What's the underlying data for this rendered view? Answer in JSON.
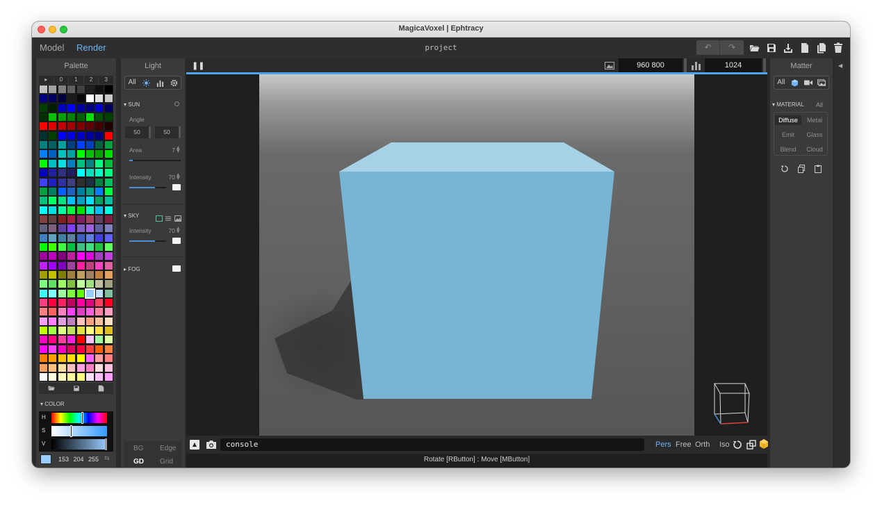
{
  "window": {
    "title": "MagicaVoxel | Ephtracy"
  },
  "topbar": {
    "modes": [
      "Model",
      "Render"
    ],
    "active_mode": "Render",
    "project_name": "project",
    "icons": [
      "undo-icon",
      "redo-icon",
      "open-folder-icon",
      "save-icon",
      "export-icon",
      "new-file-icon",
      "copy-file-icon",
      "delete-icon"
    ]
  },
  "palette": {
    "title": "Palette",
    "tabs": [
      "▸",
      "0",
      "1",
      "2",
      "3"
    ],
    "selected_color": "#99ccff",
    "footer_icons": [
      "open-folder-icon",
      "save-icon",
      "file-icon"
    ],
    "color_section": "COLOR",
    "hsv_labels": [
      "H",
      "S",
      "V"
    ],
    "rgb": "153 204 255",
    "swap_icon": "swap-icon"
  },
  "light": {
    "title": "Light",
    "filter_tabs": [
      "All",
      "sun-icon",
      "chart-icon",
      "gear-icon"
    ],
    "sun": {
      "label": "SUN",
      "angle_label": "Angle",
      "angle_values": [
        "50",
        "50"
      ],
      "area_label": "Area",
      "area_value": "7",
      "intensity_label": "Intensity",
      "intensity_value": "70",
      "intensity_fraction": 0.7,
      "area_fraction": 0.07
    },
    "sky": {
      "label": "SKY",
      "intensity_label": "Intensity",
      "intensity_value": "70",
      "intensity_fraction": 0.7
    },
    "fog": {
      "label": "FOG"
    },
    "bottom_toggles": [
      {
        "label": "BG",
        "active": false
      },
      {
        "label": "Edge",
        "active": false
      },
      {
        "label": "GD",
        "active": true
      },
      {
        "label": "Grid",
        "active": false
      }
    ]
  },
  "viewport": {
    "resolution": "960  800",
    "samples": "1024",
    "command_text": "console",
    "projections": [
      {
        "label": "Pers",
        "active": true
      },
      {
        "label": "Free",
        "active": false
      },
      {
        "label": "Orth",
        "active": false
      },
      {
        "label": "Iso",
        "active": false
      }
    ],
    "status": "Rotate [RButton] : Move [MButton]",
    "cube_color": "#78b4d4",
    "cube_top_color": "#a7d2e6",
    "background_gradient": [
      "#bdbdbd",
      "#5a5a5a"
    ]
  },
  "matter": {
    "title": "Matter",
    "filter_tabs": [
      "All",
      "cube-icon",
      "camera-icon",
      "image-icon"
    ],
    "material_label": "MATERIAL",
    "material_all": "All",
    "materials": [
      "Diffuse",
      "Metal",
      "Emit",
      "Glass",
      "Blend",
      "Cloud"
    ],
    "active_material": "Diffuse",
    "action_icons": [
      "reset-icon",
      "copy-icon",
      "paste-icon"
    ]
  },
  "colors": {
    "accent": "#6cb4f5",
    "panel_bg": "#3a3a3a",
    "progress": "#4ea3ee"
  }
}
